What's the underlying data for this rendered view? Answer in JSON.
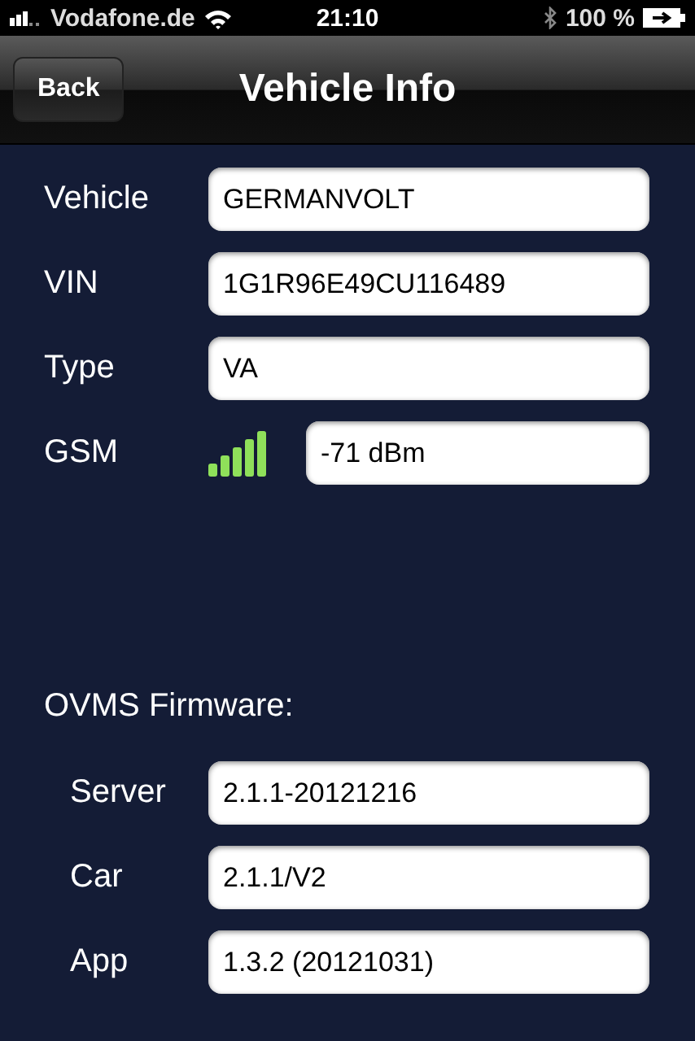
{
  "status_bar": {
    "carrier": "Vodafone.de",
    "time": "21:10",
    "battery": "100 %"
  },
  "nav_bar": {
    "back": "Back",
    "title": "Vehicle Info"
  },
  "fields": [
    {
      "label": "Vehicle",
      "value": "GERMANVOLT",
      "kind": "text"
    },
    {
      "label": "VIN",
      "value": "1G1R96E49CU116489",
      "kind": "text"
    },
    {
      "label": "Type",
      "value": "VA",
      "kind": "text"
    },
    {
      "label": "GSM",
      "value": "-71 dBm",
      "kind": "signal"
    }
  ],
  "firmware": {
    "heading": "OVMS Firmware:",
    "fields": [
      {
        "label": "Server",
        "value": "2.1.1-20121216"
      },
      {
        "label": "Car",
        "value": "2.1.1/V2"
      },
      {
        "label": "App",
        "value": "1.3.2 (20121031)"
      }
    ]
  }
}
